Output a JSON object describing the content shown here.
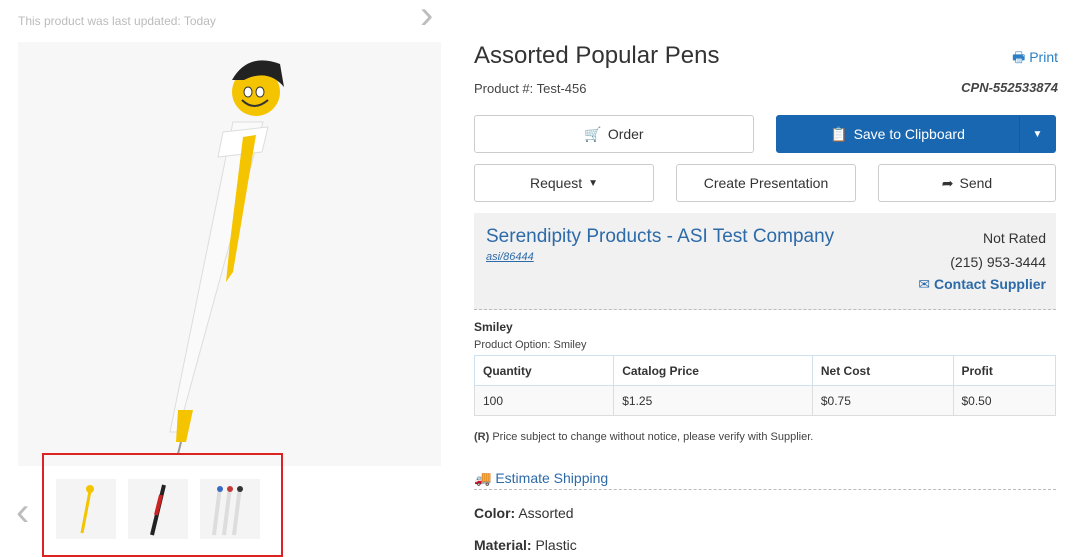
{
  "page": {
    "updated_text": "This product was last updated: Today"
  },
  "product": {
    "title": "Assorted Popular Pens",
    "print_label": "Print",
    "product_number": "Product #: Test-456",
    "cpn": "CPN-552533874"
  },
  "actions": {
    "order_label": "Order",
    "save_label": "Save to Clipboard",
    "request_label": "Request",
    "presentation_label": "Create Presentation",
    "send_label": "Send"
  },
  "supplier": {
    "name": "Serendipity Products - ASI Test Company",
    "asi": "asi/86444",
    "rating": "Not Rated",
    "phone": "(215) 953-3444",
    "contact_label": "Contact Supplier"
  },
  "option": {
    "name": "Smiley",
    "subtitle": "Product Option: Smiley"
  },
  "pricing": {
    "headers": [
      "Quantity",
      "Catalog Price",
      "Net Cost",
      "Profit"
    ],
    "rows": [
      [
        "100",
        "$1.25",
        "$0.75",
        "$0.50"
      ]
    ],
    "disclaimer_marker": "(R)",
    "disclaimer_text": " Price subject to change without notice, please verify with Supplier."
  },
  "shipping": {
    "estimate_label": "Estimate Shipping"
  },
  "attributes": {
    "color_label": "Color:",
    "color_value": " Assorted",
    "material_label": "Material:",
    "material_value": " Plastic"
  },
  "colors": {
    "primary": "#1a67b1",
    "link": "#2c6aa8",
    "highlight": "#dd2222",
    "pen_yellow": "#f5c400"
  }
}
